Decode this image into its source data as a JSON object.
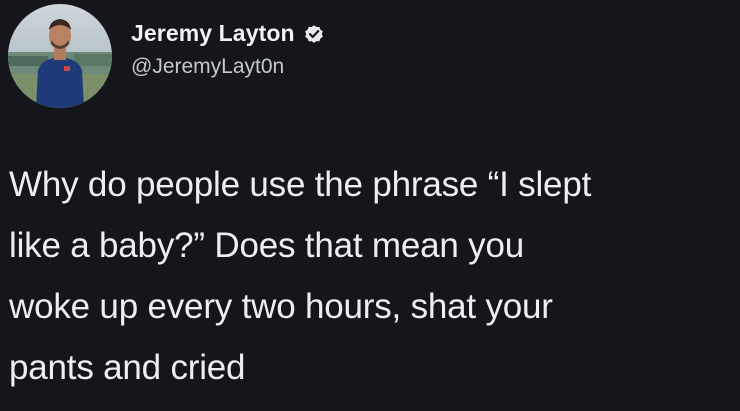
{
  "author": {
    "display_name": "Jeremy Layton",
    "handle": "@JeremyLayt0n",
    "verified": true,
    "avatar_icon": "profile-photo"
  },
  "tweet": {
    "text": "Why do people use the phrase “I slept\nlike a baby?” Does that mean you\nwoke up every two hours, shat your\npants and cried"
  },
  "colors": {
    "background": "#15161c",
    "text": "#eceef0",
    "verified_badge": "#e8eaec"
  }
}
